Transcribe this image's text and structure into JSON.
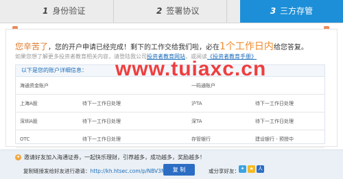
{
  "steps": [
    {
      "num": "1",
      "label": "身份验证"
    },
    {
      "num": "2",
      "label": "签署协议"
    },
    {
      "num": "3",
      "label": "三方存管"
    }
  ],
  "message": {
    "greeting": "您辛苦了",
    "part1": "，您的开户申请已经完成！剩下的工作交给我们啦，必在",
    "highlight": "1个工作日内",
    "part2": "给您答复。"
  },
  "subline": {
    "text1": "如果您想了解更多投资者教育相关内容，请登陆我公司",
    "link1": "投资者教育网站",
    "text2": "，或阅读",
    "link2": "《投资者教育手册》"
  },
  "info": {
    "title": "以下是您的账户详细信息：",
    "rows": [
      [
        "海通资金账户",
        "",
        "一码通账户",
        ""
      ],
      [
        "上海A股",
        "待下一工作日处理",
        "沪TA",
        "待下一工作日处理"
      ],
      [
        "深圳A股",
        "待下一工作日处理",
        "深TA",
        "待下一工作日处理"
      ],
      [
        "OTC",
        "待下一工作日处理",
        "存管银行",
        "建设银行 - 预授中"
      ]
    ]
  },
  "watermark": "www.tuiaxc.cn",
  "invite": {
    "text": "邀请好友加入海通证券，一起快乐理财，引荐越多，成功越多，奖励越多！",
    "copy_label": "复制链接发给好友进行邀请：",
    "url": "http://kh.htsec.com/p/NBV3Mf",
    "copy_button": "复 制",
    "share_label": "或分享好友："
  },
  "colors": {
    "accent": "#1d8fd8",
    "highlight": "#f08a2a",
    "watermark": "#ef2b2b",
    "button": "#2c6dc4"
  }
}
